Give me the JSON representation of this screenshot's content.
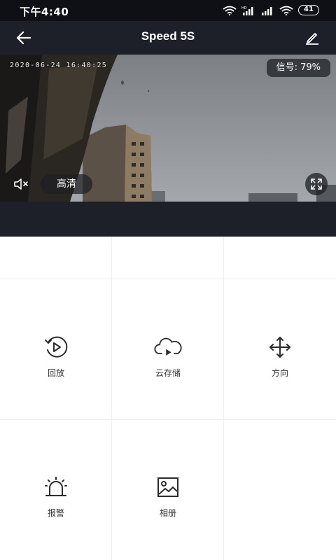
{
  "status_bar": {
    "time": "下午4:40",
    "battery": "41"
  },
  "header": {
    "title": "Speed 5S"
  },
  "video": {
    "timestamp": "2020-06-24 16:40:25",
    "signal": "信号: 79%",
    "quality": "高清"
  },
  "menu": {
    "items": [
      {
        "label": "回放",
        "icon": "playback-icon"
      },
      {
        "label": "云存储",
        "icon": "cloud-storage-icon"
      },
      {
        "label": "方向",
        "icon": "direction-icon"
      },
      {
        "label": "报警",
        "icon": "alarm-icon"
      },
      {
        "label": "相册",
        "icon": "album-icon"
      }
    ]
  },
  "colors": {
    "header_bg": "#1d2028",
    "status_bg": "#0f1015",
    "grid_line": "#efefef",
    "icon": "#2b2b2b"
  }
}
